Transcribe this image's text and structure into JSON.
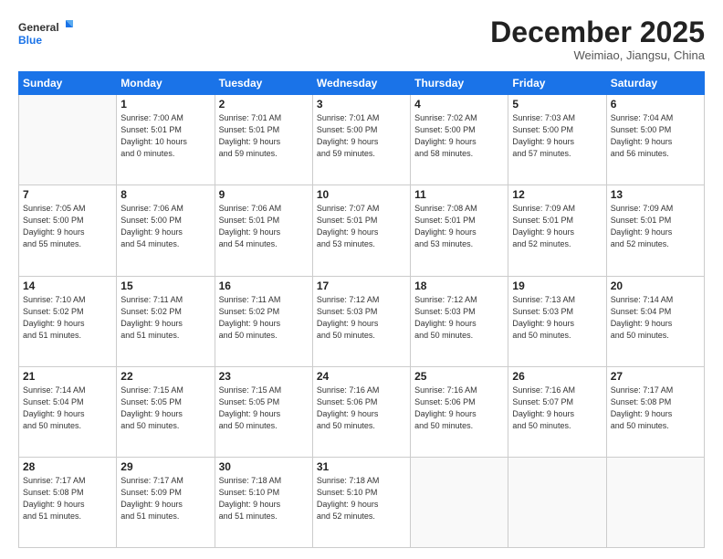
{
  "header": {
    "logo_line1": "General",
    "logo_line2": "Blue",
    "month": "December 2025",
    "location": "Weimiao, Jiangsu, China"
  },
  "days_of_week": [
    "Sunday",
    "Monday",
    "Tuesday",
    "Wednesday",
    "Thursday",
    "Friday",
    "Saturday"
  ],
  "weeks": [
    [
      {
        "day": "",
        "info": ""
      },
      {
        "day": "1",
        "info": "Sunrise: 7:00 AM\nSunset: 5:01 PM\nDaylight: 10 hours\nand 0 minutes."
      },
      {
        "day": "2",
        "info": "Sunrise: 7:01 AM\nSunset: 5:01 PM\nDaylight: 9 hours\nand 59 minutes."
      },
      {
        "day": "3",
        "info": "Sunrise: 7:01 AM\nSunset: 5:00 PM\nDaylight: 9 hours\nand 59 minutes."
      },
      {
        "day": "4",
        "info": "Sunrise: 7:02 AM\nSunset: 5:00 PM\nDaylight: 9 hours\nand 58 minutes."
      },
      {
        "day": "5",
        "info": "Sunrise: 7:03 AM\nSunset: 5:00 PM\nDaylight: 9 hours\nand 57 minutes."
      },
      {
        "day": "6",
        "info": "Sunrise: 7:04 AM\nSunset: 5:00 PM\nDaylight: 9 hours\nand 56 minutes."
      }
    ],
    [
      {
        "day": "7",
        "info": "Sunrise: 7:05 AM\nSunset: 5:00 PM\nDaylight: 9 hours\nand 55 minutes."
      },
      {
        "day": "8",
        "info": "Sunrise: 7:06 AM\nSunset: 5:00 PM\nDaylight: 9 hours\nand 54 minutes."
      },
      {
        "day": "9",
        "info": "Sunrise: 7:06 AM\nSunset: 5:01 PM\nDaylight: 9 hours\nand 54 minutes."
      },
      {
        "day": "10",
        "info": "Sunrise: 7:07 AM\nSunset: 5:01 PM\nDaylight: 9 hours\nand 53 minutes."
      },
      {
        "day": "11",
        "info": "Sunrise: 7:08 AM\nSunset: 5:01 PM\nDaylight: 9 hours\nand 53 minutes."
      },
      {
        "day": "12",
        "info": "Sunrise: 7:09 AM\nSunset: 5:01 PM\nDaylight: 9 hours\nand 52 minutes."
      },
      {
        "day": "13",
        "info": "Sunrise: 7:09 AM\nSunset: 5:01 PM\nDaylight: 9 hours\nand 52 minutes."
      }
    ],
    [
      {
        "day": "14",
        "info": "Sunrise: 7:10 AM\nSunset: 5:02 PM\nDaylight: 9 hours\nand 51 minutes."
      },
      {
        "day": "15",
        "info": "Sunrise: 7:11 AM\nSunset: 5:02 PM\nDaylight: 9 hours\nand 51 minutes."
      },
      {
        "day": "16",
        "info": "Sunrise: 7:11 AM\nSunset: 5:02 PM\nDaylight: 9 hours\nand 50 minutes."
      },
      {
        "day": "17",
        "info": "Sunrise: 7:12 AM\nSunset: 5:03 PM\nDaylight: 9 hours\nand 50 minutes."
      },
      {
        "day": "18",
        "info": "Sunrise: 7:12 AM\nSunset: 5:03 PM\nDaylight: 9 hours\nand 50 minutes."
      },
      {
        "day": "19",
        "info": "Sunrise: 7:13 AM\nSunset: 5:03 PM\nDaylight: 9 hours\nand 50 minutes."
      },
      {
        "day": "20",
        "info": "Sunrise: 7:14 AM\nSunset: 5:04 PM\nDaylight: 9 hours\nand 50 minutes."
      }
    ],
    [
      {
        "day": "21",
        "info": "Sunrise: 7:14 AM\nSunset: 5:04 PM\nDaylight: 9 hours\nand 50 minutes."
      },
      {
        "day": "22",
        "info": "Sunrise: 7:15 AM\nSunset: 5:05 PM\nDaylight: 9 hours\nand 50 minutes."
      },
      {
        "day": "23",
        "info": "Sunrise: 7:15 AM\nSunset: 5:05 PM\nDaylight: 9 hours\nand 50 minutes."
      },
      {
        "day": "24",
        "info": "Sunrise: 7:16 AM\nSunset: 5:06 PM\nDaylight: 9 hours\nand 50 minutes."
      },
      {
        "day": "25",
        "info": "Sunrise: 7:16 AM\nSunset: 5:06 PM\nDaylight: 9 hours\nand 50 minutes."
      },
      {
        "day": "26",
        "info": "Sunrise: 7:16 AM\nSunset: 5:07 PM\nDaylight: 9 hours\nand 50 minutes."
      },
      {
        "day": "27",
        "info": "Sunrise: 7:17 AM\nSunset: 5:08 PM\nDaylight: 9 hours\nand 50 minutes."
      }
    ],
    [
      {
        "day": "28",
        "info": "Sunrise: 7:17 AM\nSunset: 5:08 PM\nDaylight: 9 hours\nand 51 minutes."
      },
      {
        "day": "29",
        "info": "Sunrise: 7:17 AM\nSunset: 5:09 PM\nDaylight: 9 hours\nand 51 minutes."
      },
      {
        "day": "30",
        "info": "Sunrise: 7:18 AM\nSunset: 5:10 PM\nDaylight: 9 hours\nand 51 minutes."
      },
      {
        "day": "31",
        "info": "Sunrise: 7:18 AM\nSunset: 5:10 PM\nDaylight: 9 hours\nand 52 minutes."
      },
      {
        "day": "",
        "info": ""
      },
      {
        "day": "",
        "info": ""
      },
      {
        "day": "",
        "info": ""
      }
    ]
  ]
}
